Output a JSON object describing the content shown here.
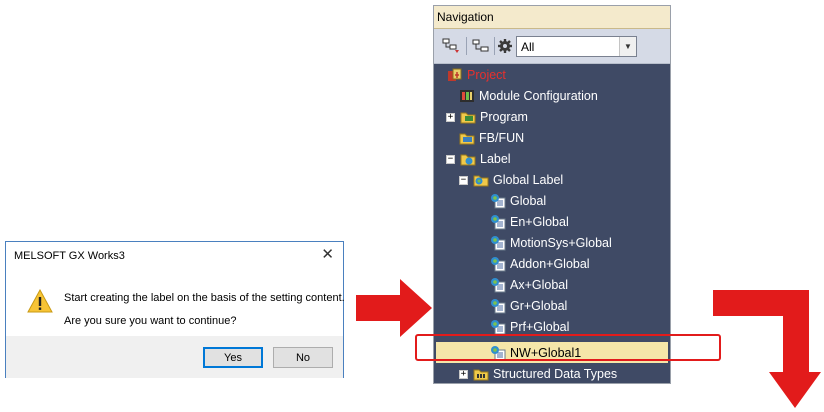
{
  "dialog": {
    "title": "MELSOFT GX Works3",
    "close_glyph": "✕",
    "message_line1": "Start creating the label on the basis of the setting content.",
    "message_line2": "Are you sure you want to continue?",
    "yes_label": "Yes",
    "no_label": "No",
    "icon": "warning-icon"
  },
  "navigation": {
    "title": "Navigation",
    "filter_value": "All",
    "toolbar_icons": [
      "collapse-tree-icon",
      "tree-view-icon",
      "settings-gear-icon"
    ],
    "tree": [
      {
        "label": "Project",
        "icon": "project-icon",
        "expander": ""
      },
      {
        "label": "Module Configuration",
        "icon": "module-configuration-icon",
        "expander": ""
      },
      {
        "label": "Program",
        "icon": "program-folder-icon",
        "expander": "+"
      },
      {
        "label": "FB/FUN",
        "icon": "fb-fun-folder-icon",
        "expander": ""
      },
      {
        "label": "Label",
        "icon": "label-folder-icon",
        "expander": "−"
      },
      {
        "label": "Global Label",
        "icon": "global-label-icon",
        "expander": "−"
      },
      {
        "label": "Global",
        "icon": "global-label-file-icon",
        "expander": ""
      },
      {
        "label": "En+Global",
        "icon": "global-label-file-icon",
        "expander": ""
      },
      {
        "label": "MotionSys+Global",
        "icon": "global-label-file-icon",
        "expander": ""
      },
      {
        "label": "Addon+Global",
        "icon": "global-label-file-icon",
        "expander": ""
      },
      {
        "label": "Ax+Global",
        "icon": "global-label-file-icon",
        "expander": ""
      },
      {
        "label": "Gr+Global",
        "icon": "global-label-file-icon",
        "expander": ""
      },
      {
        "label": "Prf+Global",
        "icon": "global-label-file-icon",
        "expander": ""
      },
      {
        "label": "NW+Global1",
        "icon": "global-label-file-icon",
        "expander": "",
        "selected": true
      },
      {
        "label": "Structured Data Types",
        "icon": "structured-data-types-icon",
        "expander": "+"
      }
    ]
  },
  "colors": {
    "nav_background": "#3f4a65",
    "selection": "#f5e6a9",
    "arrow_red": "#e21b1b",
    "project_red": "#e8302d"
  }
}
